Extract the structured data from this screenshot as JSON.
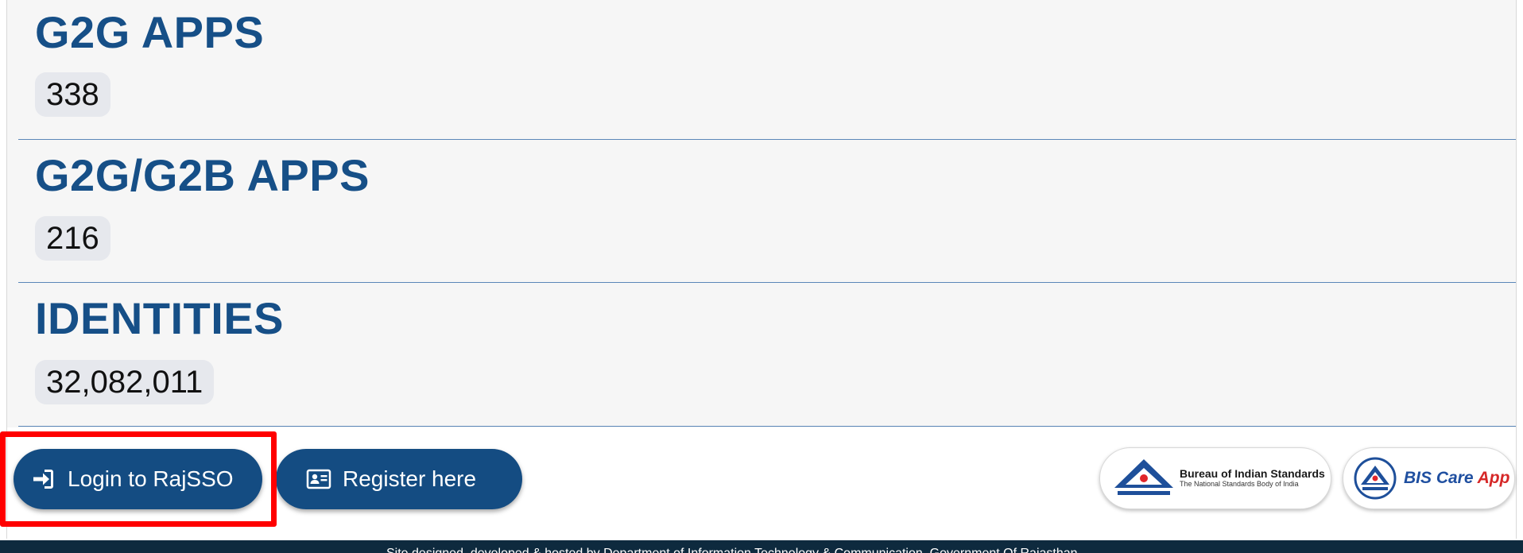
{
  "stats": [
    {
      "title": "G2G APPS",
      "value": "338"
    },
    {
      "title": "G2G/G2B APPS",
      "value": "216"
    },
    {
      "title": "IDENTITIES",
      "value": "32,082,011"
    }
  ],
  "actions": {
    "login_label": "Login to RajSSO",
    "register_label": "Register here"
  },
  "partners": {
    "bis_name": "Bureau of Indian Standards",
    "bis_tagline": "The National Standards Body of India",
    "bis_care_word": "BIS Care",
    "bis_care_app": "App"
  },
  "footer": {
    "text": "Site designed, developed & hosted by Department of Information Technology & Communication, Government Of Rajasthan"
  },
  "colors": {
    "heading": "#164f87",
    "button": "#144c82",
    "divider": "#5b87b8",
    "highlight": "#ff0000",
    "footer_bg": "#0e2a3e"
  },
  "icons": {
    "login": "sign-in-icon",
    "register": "id-card-icon"
  }
}
